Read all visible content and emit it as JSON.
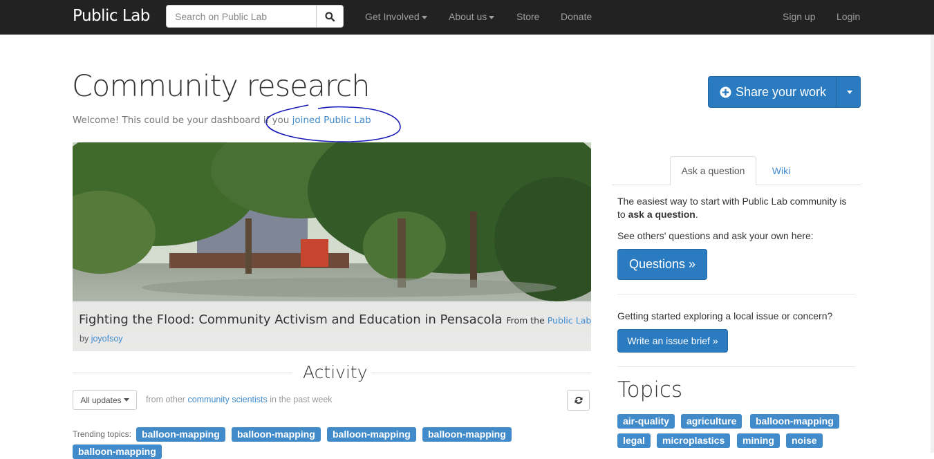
{
  "nav": {
    "brand": "Public Lab",
    "search_placeholder": "Search on Public Lab",
    "links": [
      "Get Involved",
      "About us",
      "Store",
      "Donate"
    ],
    "signup": "Sign up",
    "login": "Login"
  },
  "header": {
    "title": "Community research",
    "welcome_prefix": "Welcome! This could be your dashboard if you ",
    "welcome_link": "joined Public Lab",
    "share_label": "Share your work"
  },
  "featured": {
    "title": "Fighting the Flood: Community Activism and Education in Pensacola",
    "from_prefix": "From the ",
    "from_link": "Public Lab Blog",
    "by_prefix": "by ",
    "author": "joyofsoy"
  },
  "activity": {
    "heading": "Activity",
    "filter_label": "All updates",
    "filter_prefix": "from other ",
    "filter_link": "community scientists",
    "filter_suffix": " in the past week",
    "trending_label": "Trending topics:",
    "trending_tags": [
      "balloon-mapping",
      "balloon-mapping",
      "balloon-mapping",
      "balloon-mapping",
      "balloon-mapping"
    ]
  },
  "sidebar": {
    "tabs": [
      "Ask a question",
      "Wiki"
    ],
    "intro_prefix": "The easiest way to start with Public Lab community is to ",
    "intro_bold": "ask a question",
    "intro_suffix": ".",
    "see_others": "See others' questions and ask your own here:",
    "questions_button": "Questions »",
    "getting_started": "Getting started exploring a local issue or concern?",
    "issue_brief_button": "Write an issue brief »",
    "topics_heading": "Topics",
    "topics": [
      "air-quality",
      "agriculture",
      "balloon-mapping",
      "legal",
      "microplastics",
      "mining",
      "noise"
    ]
  },
  "colors": {
    "navbar": "#222222",
    "primary": "#2a7bc0",
    "link": "#428bca",
    "annotation": "#1a1ab8"
  }
}
